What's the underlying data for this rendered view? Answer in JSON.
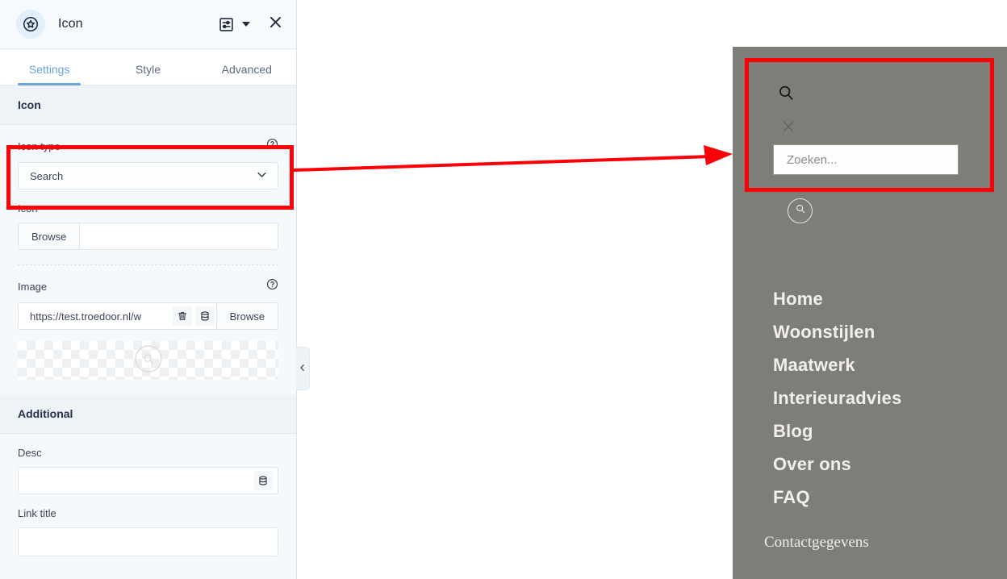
{
  "editor": {
    "header": {
      "badge_icon": "star-circle-icon",
      "title": "Icon",
      "settings_icon": "sliders-icon",
      "dropdown_icon": "caret-down-icon",
      "close_icon": "close-icon"
    },
    "tabs": [
      {
        "label": "Settings",
        "active": true
      },
      {
        "label": "Style",
        "active": false
      },
      {
        "label": "Advanced",
        "active": false
      }
    ],
    "sections": [
      {
        "title": "Icon",
        "fields": {
          "icon_type": {
            "label": "Icon type",
            "help_icon": "help-circle-icon",
            "value": "Search",
            "chevron_icon": "chevron-down-icon"
          },
          "icon": {
            "label": "Icon",
            "browse_label": "Browse",
            "value": ""
          },
          "image": {
            "label": "Image",
            "help_icon": "help-circle-icon",
            "value": "https://test.troedoor.nl/w",
            "delete_icon": "trash-icon",
            "database_icon": "database-icon",
            "browse_label": "Browse",
            "preview_icon": "search-circle-icon"
          }
        }
      },
      {
        "title": "Additional",
        "fields": {
          "desc": {
            "label": "Desc",
            "value": "",
            "database_icon": "database-icon"
          },
          "link_title": {
            "label": "Link title",
            "value": ""
          }
        }
      }
    ],
    "collapse_handle_icon": "chevron-left-icon"
  },
  "preview": {
    "background_color": "#7e7e79",
    "search_icon": "search-icon",
    "close_icon": "close-icon",
    "search_input": {
      "placeholder": "Zoeken...",
      "value": ""
    },
    "search_circle_button_icon": "search-icon",
    "nav_links": [
      "Home",
      "Woonstijlen",
      "Maatwerk",
      "Interieuradvies",
      "Blog",
      "Over ons",
      "FAQ"
    ],
    "contact_heading": "Contactgegevens"
  },
  "annotations": {
    "color": "#fb0007",
    "arrow_direction": "right",
    "boxes": [
      "icon-type-field",
      "preview-search-area"
    ]
  }
}
